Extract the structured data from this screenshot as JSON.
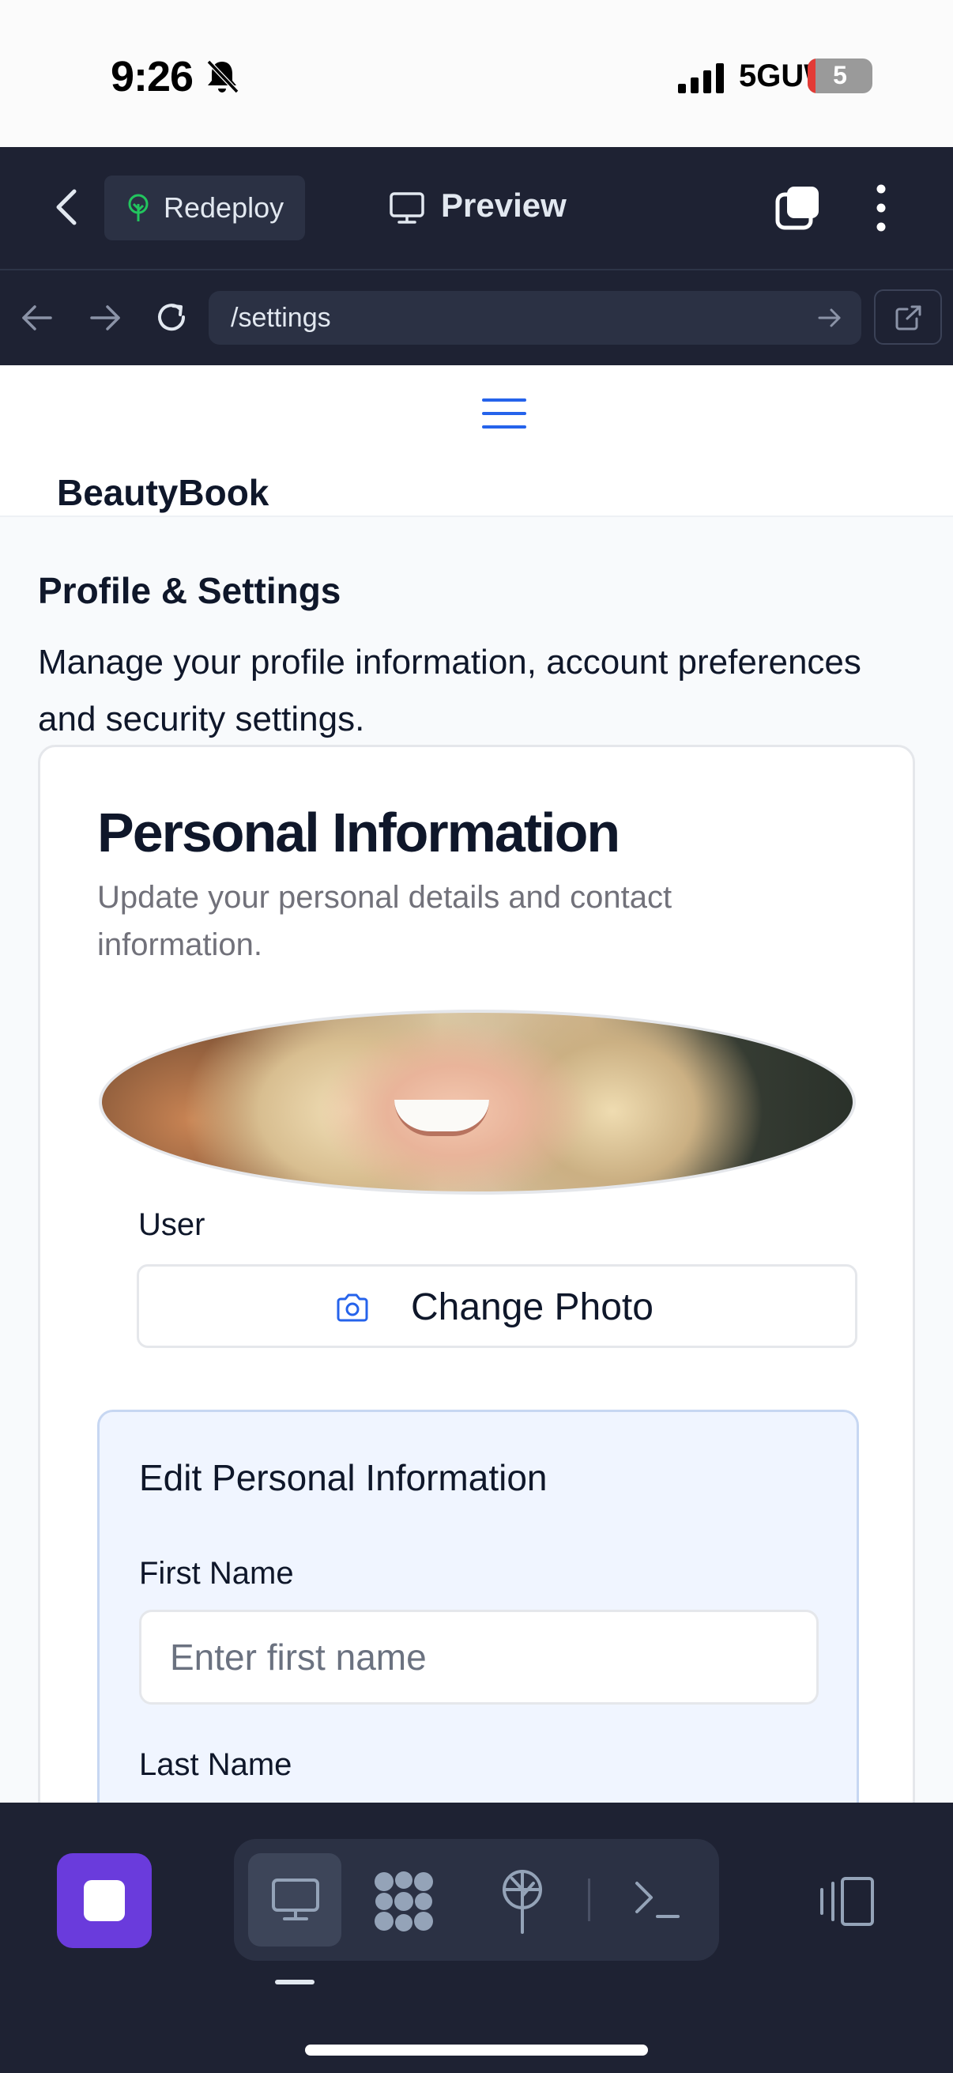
{
  "status_bar": {
    "time": "9:26",
    "network": "5GUW",
    "battery": "5",
    "icons": [
      "bell-slash-icon",
      "signal-icon"
    ]
  },
  "app_header": {
    "redeploy_label": "Redeploy",
    "preview_label": "Preview",
    "icons": [
      "back-chevron-icon",
      "tree-icon",
      "monitor-icon",
      "tabs-icon",
      "more-vertical-icon"
    ]
  },
  "browser": {
    "url": "/settings",
    "icons": [
      "arrow-left-icon",
      "arrow-right-icon",
      "reload-icon",
      "go-arrow-icon",
      "external-link-icon"
    ]
  },
  "site": {
    "brand": "BeautyBook",
    "page_title": "Profile & Settings",
    "page_description": "Manage your profile information, account preferences and security settings."
  },
  "personal_info": {
    "title": "Personal Information",
    "subtitle": "Update your personal details and contact information.",
    "user_label": "User",
    "change_photo_label": "Change Photo"
  },
  "edit_form": {
    "title": "Edit Personal Information",
    "first_name_label": "First Name",
    "first_name_placeholder": "Enter first name",
    "first_name_value": "",
    "last_name_label": "Last Name"
  },
  "bottom_toolbar": {
    "icons": [
      "stop-icon",
      "desktop-icon",
      "apps-grid-icon",
      "deploy-icon",
      "terminal-icon",
      "split-view-icon"
    ]
  },
  "colors": {
    "app_bg": "#1e2233",
    "accent_purple": "#6a3bdc",
    "link_blue": "#2563eb"
  }
}
